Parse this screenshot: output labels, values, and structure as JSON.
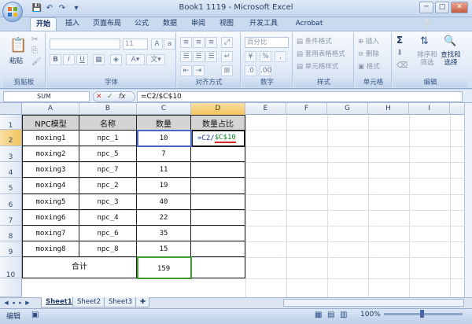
{
  "window": {
    "title": "Book1 1119 - Microsoft Excel",
    "min_label": "─",
    "max_label": "▢",
    "close_label": "✕"
  },
  "qat": {
    "save_icon": "💾",
    "undo_icon": "↶",
    "redo_icon": "↷",
    "customize_icon": "▾"
  },
  "ribbon": {
    "tabs": [
      "开始",
      "插入",
      "页面布局",
      "公式",
      "数据",
      "审阅",
      "视图",
      "开发工具",
      "Acrobat"
    ],
    "groups": {
      "clipboard": {
        "label": "剪贴板",
        "paste": "粘贴"
      },
      "font": {
        "label": "字体",
        "size": "11",
        "bold": "B",
        "italic": "I",
        "underline": "U"
      },
      "alignment": {
        "label": "对齐方式"
      },
      "number": {
        "label": "数字",
        "format": "百分比",
        "percent": "%",
        "comma": ","
      },
      "styles": {
        "label": "样式",
        "items": [
          "条件格式",
          "套用表格格式",
          "单元格样式"
        ]
      },
      "cells": {
        "label": "单元格",
        "items": [
          "插入",
          "删除",
          "格式"
        ]
      },
      "editing": {
        "label": "编辑",
        "sum": "Σ",
        "sort": "排序和\n筛选",
        "find": "查找和\n选择"
      }
    }
  },
  "formula_bar": {
    "name_box": "SUM",
    "fx": "fx",
    "formula": "=C2/$C$10"
  },
  "sheet": {
    "columns": [
      "A",
      "B",
      "C",
      "D",
      "E",
      "F",
      "G",
      "H",
      "I"
    ],
    "rows": [
      "1",
      "2",
      "3",
      "4",
      "5",
      "6",
      "7",
      "8",
      "9",
      "10"
    ],
    "headers": [
      "NPC模型",
      "名称",
      "数量",
      "数量占比"
    ],
    "data": [
      [
        "moxing1",
        "npc_1",
        "10"
      ],
      [
        "moxing2",
        "npc_5",
        "7"
      ],
      [
        "moxing3",
        "npc_7",
        "11"
      ],
      [
        "moxing4",
        "npc_2",
        "19"
      ],
      [
        "moxing5",
        "npc_3",
        "40"
      ],
      [
        "moxing6",
        "npc_4",
        "22"
      ],
      [
        "moxing7",
        "npc_6",
        "35"
      ],
      [
        "moxing8",
        "npc_8",
        "15"
      ]
    ],
    "total_label": "合计",
    "total_value": "159",
    "edit_part1": "=C2/",
    "edit_part2": "$C$10"
  },
  "sheet_tabs": [
    "Sheet1",
    "Sheet2",
    "Sheet3"
  ],
  "status": {
    "mode": "编辑",
    "zoom": "100%"
  }
}
